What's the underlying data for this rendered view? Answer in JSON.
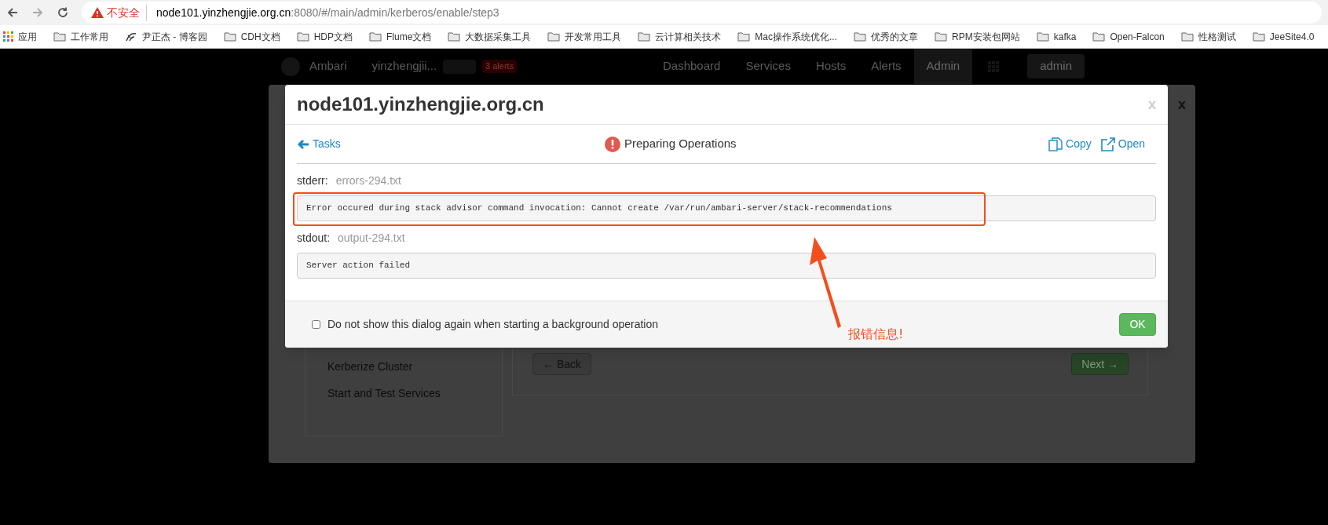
{
  "browser": {
    "insecure_label": "不安全",
    "url_host": "node101.yinzhengjie.org.cn",
    "url_rest": ":8080/#/main/admin/kerberos/enable/step3"
  },
  "bookmarks": [
    {
      "kind": "apps",
      "label": "应用"
    },
    {
      "kind": "folder",
      "label": "工作常用"
    },
    {
      "kind": "site",
      "label": "尹正杰 - 博客园"
    },
    {
      "kind": "folder",
      "label": "CDH文档"
    },
    {
      "kind": "folder",
      "label": "HDP文档"
    },
    {
      "kind": "folder",
      "label": "Flume文档"
    },
    {
      "kind": "folder",
      "label": "大数据采集工具"
    },
    {
      "kind": "folder",
      "label": "开发常用工具"
    },
    {
      "kind": "folder",
      "label": "云计算相关技术"
    },
    {
      "kind": "folder",
      "label": "Mac操作系统优化..."
    },
    {
      "kind": "folder",
      "label": "优秀的文章"
    },
    {
      "kind": "folder",
      "label": "RPM安装包网站"
    },
    {
      "kind": "folder",
      "label": "kafka"
    },
    {
      "kind": "folder",
      "label": "Open-Falcon"
    },
    {
      "kind": "folder",
      "label": "性格测试"
    },
    {
      "kind": "folder",
      "label": "JeeSite4.0"
    }
  ],
  "app_nav": {
    "brand": "Ambari",
    "cluster": "yinzhengjii...",
    "alerts_badge": "3 alerts",
    "items": [
      {
        "label": "Dashboard",
        "selected": false
      },
      {
        "label": "Services",
        "selected": false
      },
      {
        "label": "Hosts",
        "selected": false
      },
      {
        "label": "Alerts",
        "selected": false
      },
      {
        "label": "Admin",
        "selected": true
      }
    ],
    "user": "admin"
  },
  "wizard": {
    "close": "x",
    "steps": [
      "Kerberize Cluster",
      "Start and Test Services"
    ],
    "back_button": "← Back",
    "next_button": "Next →"
  },
  "dialog": {
    "title": "node101.yinzhengjie.org.cn",
    "close": "x",
    "back_link": "Tasks",
    "status": "Preparing Operations",
    "copy": "Copy",
    "open": "Open",
    "logs": [
      {
        "label": "stderr:",
        "file": "errors-294.txt",
        "text": "Error occured during stack advisor command invocation: Cannot create /var/run/ambari-server/stack-recommendations",
        "highlighted": true
      },
      {
        "label": "stdout:",
        "file": "output-294.txt",
        "text": "Server action failed",
        "highlighted": false
      }
    ],
    "dont_show_again": {
      "label": "Do not show this dialog again when starting a background operation",
      "checked": false
    },
    "ok_button": "OK"
  },
  "annotation": {
    "text": "报错信息!"
  }
}
